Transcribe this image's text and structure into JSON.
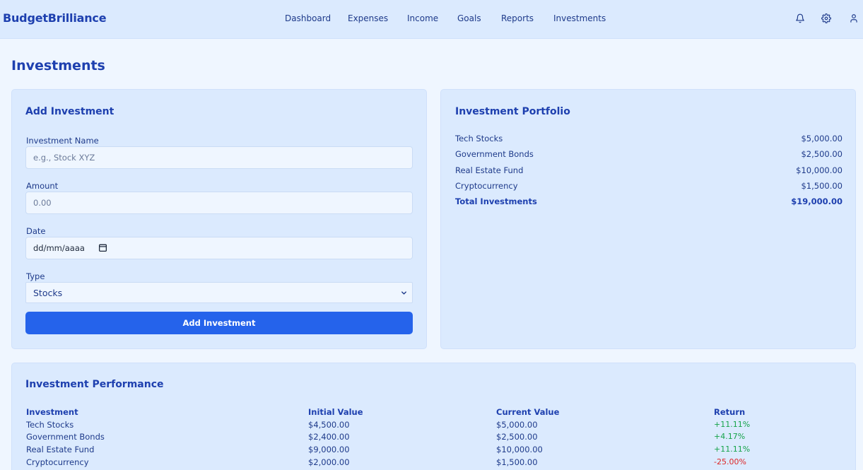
{
  "app": {
    "brand": "BudgetBrilliance"
  },
  "nav": {
    "items": [
      {
        "label": "Dashboard"
      },
      {
        "label": "Expenses"
      },
      {
        "label": "Income"
      },
      {
        "label": "Goals"
      },
      {
        "label": "Reports"
      },
      {
        "label": "Investments"
      }
    ]
  },
  "header_icons": [
    "bell-icon",
    "gear-icon",
    "user-icon"
  ],
  "page": {
    "title": "Investments"
  },
  "form": {
    "title": "Add Investment",
    "name_label": "Investment Name",
    "name_placeholder": "e.g., Stock XYZ",
    "amount_label": "Amount",
    "amount_placeholder": "0.00",
    "date_label": "Date",
    "date_placeholder": "dd/mm/aaaa",
    "type_label": "Type",
    "type_selected": "Stocks",
    "submit_label": "Add Investment"
  },
  "portfolio": {
    "title": "Investment Portfolio",
    "items": [
      {
        "name": "Tech Stocks",
        "value": "$5,000.00"
      },
      {
        "name": "Government Bonds",
        "value": "$2,500.00"
      },
      {
        "name": "Real Estate Fund",
        "value": "$10,000.00"
      },
      {
        "name": "Cryptocurrency",
        "value": "$1,500.00"
      }
    ],
    "total_label": "Total Investments",
    "total_value": "$19,000.00"
  },
  "performance": {
    "title": "Investment Performance",
    "columns": [
      "Investment",
      "Initial Value",
      "Current Value",
      "Return"
    ],
    "rows": [
      {
        "investment": "Tech Stocks",
        "initial": "$4,500.00",
        "current": "$5,000.00",
        "return": "+11.11%"
      },
      {
        "investment": "Government Bonds",
        "initial": "$2,400.00",
        "current": "$2,500.00",
        "return": "+4.17%"
      },
      {
        "investment": "Real Estate Fund",
        "initial": "$9,000.00",
        "current": "$10,000.00",
        "return": "+11.11%"
      },
      {
        "investment": "Cryptocurrency",
        "initial": "$2,000.00",
        "current": "$1,500.00",
        "return": "-25.00%"
      }
    ]
  },
  "colors": {
    "header_bg": "#dbeafe",
    "page_bg": "#eff6ff",
    "card_bg": "#dbeafe",
    "primary": "#2563eb",
    "text": "#1e3a8a",
    "positive": "#16a34a",
    "negative": "#dc2626"
  }
}
